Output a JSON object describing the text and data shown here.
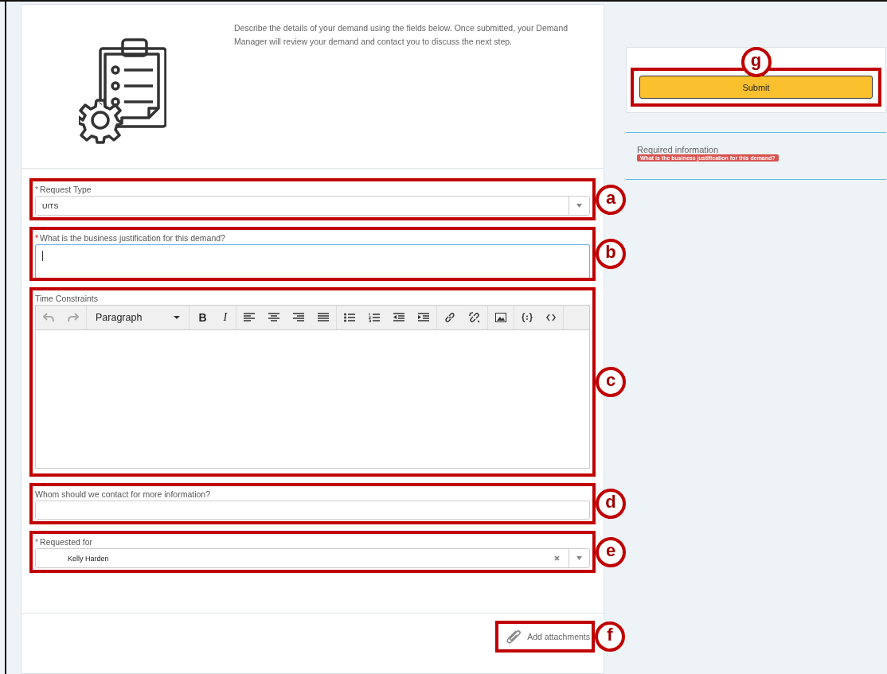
{
  "intro": {
    "text": "Describe the details of your demand using the fields below. Once submitted, your Demand Manager will review your demand and contact you to discuss the next step."
  },
  "fields": [
    {
      "kind": "select",
      "marker": "*",
      "label": "Request Type",
      "invalid": false,
      "value": "UITS",
      "callout": "a"
    },
    {
      "kind": "textarea",
      "marker": "*",
      "label": "What is the business justification for this demand?",
      "invalid": true,
      "focused": true,
      "callout": "b"
    },
    {
      "kind": "editor",
      "label": "Time Constraints",
      "callout": "c",
      "toolbar": {
        "format": "Paragraph",
        "bold": "B",
        "italic": "I"
      }
    },
    {
      "kind": "text",
      "label": "Whom should we contact for more information?",
      "callout": "d"
    },
    {
      "kind": "reference",
      "marker": "*",
      "label": "Requested for",
      "invalid": false,
      "value": "Kelly Harden",
      "callout": "e"
    }
  ],
  "attachments": {
    "label": "Add attachments",
    "callout": "f"
  },
  "sidebar": {
    "submit": "Submit",
    "callout": "g",
    "required_title": "Required information",
    "required_items": [
      "What is the business justification for this demand?"
    ]
  }
}
